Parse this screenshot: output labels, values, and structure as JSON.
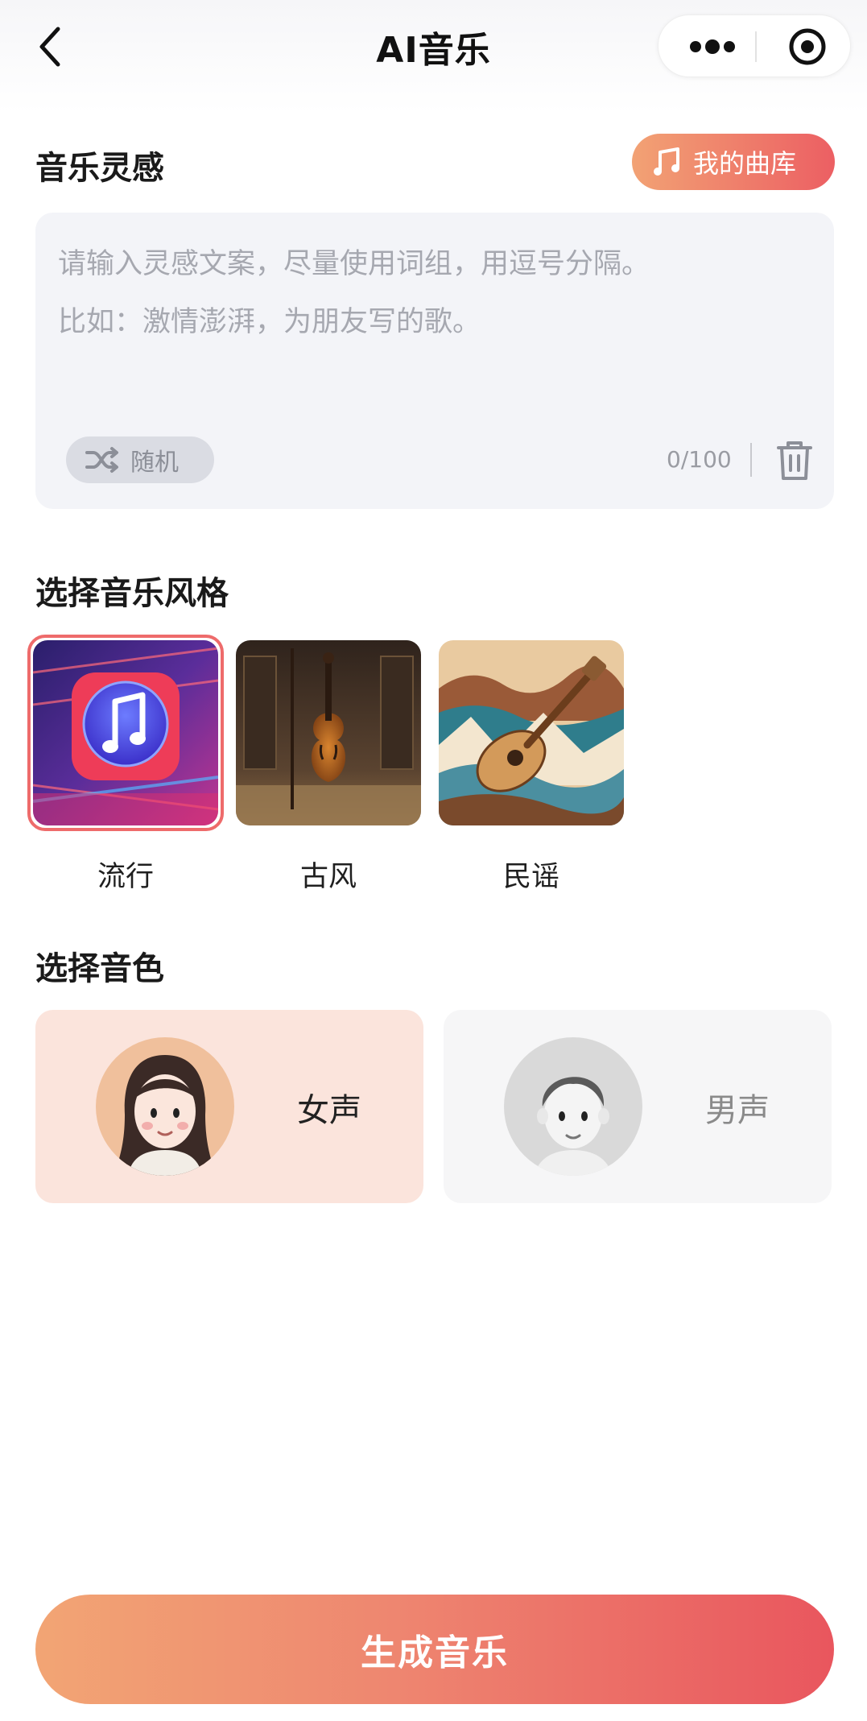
{
  "navbar": {
    "title": "AI音乐",
    "back_icon": "chevron-left-icon",
    "more_icon": "more-dots-icon",
    "close_icon": "target-close-icon"
  },
  "inspiration": {
    "title": "音乐灵感",
    "library_button": "我的曲库",
    "library_icon": "music-note-icon",
    "placeholder_line1": "请输入灵感文案，尽量使用词组，用逗号分隔。",
    "placeholder_line2": "比如：激情澎湃，为朋友写的歌。",
    "random_button": "随机",
    "random_icon": "shuffle-icon",
    "counter": "0/100",
    "clear_icon": "trash-icon"
  },
  "styles": {
    "title": "选择音乐风格",
    "items": [
      {
        "label": "流行",
        "selected": true,
        "image": "pop-music-note-app-icon"
      },
      {
        "label": "古风",
        "selected": false,
        "image": "violin-in-room"
      },
      {
        "label": "民谣",
        "selected": false,
        "image": "guitar-landscape-art"
      }
    ]
  },
  "voices": {
    "title": "选择音色",
    "items": [
      {
        "label": "女声",
        "selected": true,
        "avatar": "female-avatar"
      },
      {
        "label": "男声",
        "selected": false,
        "avatar": "male-avatar"
      }
    ]
  },
  "generate_button": "生成音乐",
  "colors": {
    "accent_start": "#f2a574",
    "accent_end": "#e9565e",
    "selected_ring": "#ee6b6b",
    "female_card_bg": "#fbe4dc",
    "input_bg": "#f3f4f8"
  }
}
